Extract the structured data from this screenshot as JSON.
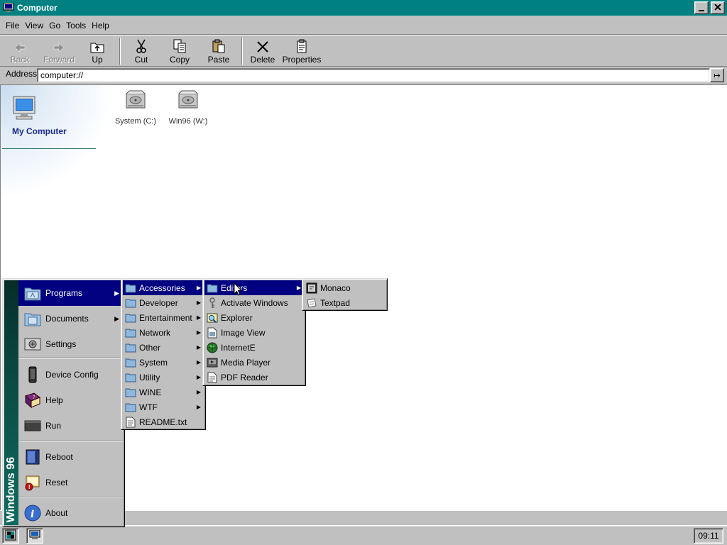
{
  "window": {
    "title": "Computer",
    "minimize_label": "_",
    "close_label": "✕"
  },
  "menubar": [
    "File",
    "View",
    "Go",
    "Tools",
    "Help"
  ],
  "toolbar": {
    "back": "Back",
    "forward": "Forward",
    "up": "Up",
    "cut": "Cut",
    "copy": "Copy",
    "paste": "Paste",
    "delete": "Delete",
    "properties": "Properties"
  },
  "address": {
    "label": "Address",
    "value": "computer://",
    "go_label": "↦"
  },
  "sidebar": {
    "title": "My Computer"
  },
  "drives": [
    {
      "label": "System (C:)"
    },
    {
      "label": "Win96 (W:)"
    }
  ],
  "taskbar": {
    "clock": "09:11"
  },
  "start_menu": {
    "brand": "Windows 96",
    "items": [
      {
        "label": "Programs",
        "icon": "programs-folder-icon",
        "submenu": true
      },
      {
        "label": "Documents",
        "icon": "documents-folder-icon",
        "submenu": true
      },
      {
        "label": "Settings",
        "icon": "settings-icon",
        "submenu": false
      },
      {
        "label": "Device Config",
        "icon": "device-icon",
        "submenu": false
      },
      {
        "label": "Help",
        "icon": "help-book-icon",
        "submenu": false
      },
      {
        "label": "Run",
        "icon": "run-icon",
        "submenu": false
      },
      {
        "label": "Reboot",
        "icon": "reboot-icon",
        "submenu": false
      },
      {
        "label": "Reset",
        "icon": "reset-icon",
        "submenu": false
      },
      {
        "label": "About",
        "icon": "info-icon",
        "submenu": false
      }
    ]
  },
  "programs_menu": [
    {
      "label": "Accessories",
      "submenu": true
    },
    {
      "label": "Developer",
      "submenu": true
    },
    {
      "label": "Entertainment",
      "submenu": true
    },
    {
      "label": "Network",
      "submenu": true
    },
    {
      "label": "Other",
      "submenu": true
    },
    {
      "label": "System",
      "submenu": true
    },
    {
      "label": "Utility",
      "submenu": true
    },
    {
      "label": "WINE",
      "submenu": true
    },
    {
      "label": "WTF",
      "submenu": true
    },
    {
      "label": "README.txt",
      "submenu": false
    }
  ],
  "accessories_menu": [
    {
      "label": "Editors",
      "submenu": true
    },
    {
      "label": "Activate Windows",
      "submenu": false
    },
    {
      "label": "Explorer",
      "submenu": false
    },
    {
      "label": "Image View",
      "submenu": false
    },
    {
      "label": "InternetE",
      "submenu": false
    },
    {
      "label": "Media Player",
      "submenu": false
    },
    {
      "label": "PDF Reader",
      "submenu": false
    }
  ],
  "editors_menu": [
    {
      "label": "Monaco"
    },
    {
      "label": "Textpad"
    }
  ],
  "colors": {
    "title_bar": "#008080",
    "selection": "#000080",
    "face": "#c0c0c0"
  }
}
